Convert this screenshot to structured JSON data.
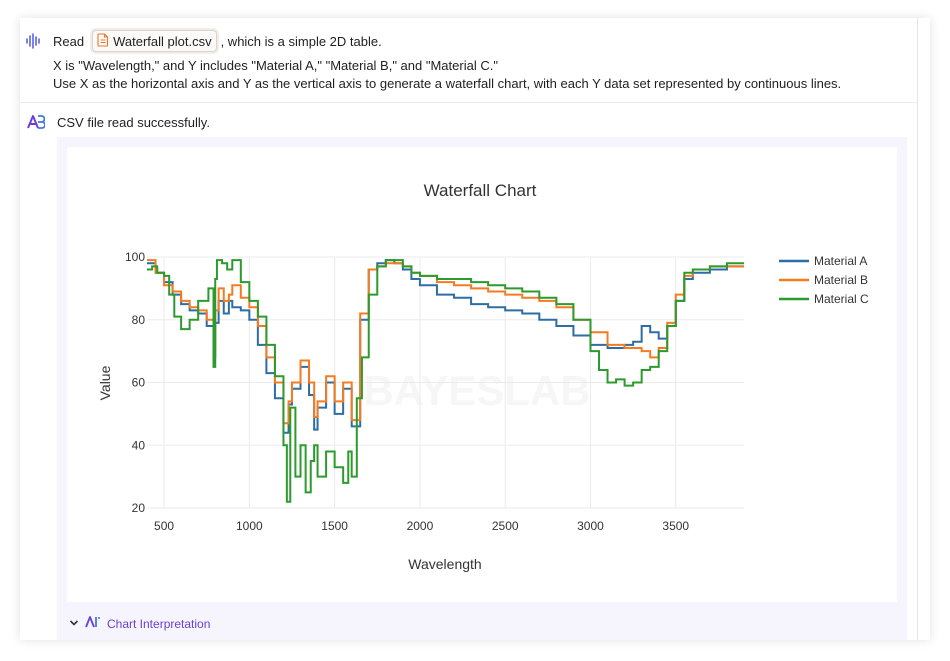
{
  "user_message": {
    "read_prefix": "Read",
    "file_name": "Waterfall plot.csv",
    "read_suffix": ", which is a simple 2D table.",
    "line2": "X is \"Wavelength,\" and Y includes \"Material A,\" \"Material B,\" and \"Material C.\"",
    "line3": "Use X as the horizontal axis and Y as the vertical axis to generate a waterfall chart, with each Y data set represented by continuous lines."
  },
  "assistant": {
    "status": "CSV file read successfully.",
    "interpretation_label": "Chart Interpretation"
  },
  "colors": {
    "material_a": "#2e6da4",
    "material_b": "#f47b20",
    "material_c": "#2c9a2c",
    "accent": "#6b3fd6"
  },
  "chart_data": {
    "type": "line",
    "title": "Waterfall Chart",
    "xlabel": "Wavelength",
    "ylabel": "Value",
    "xlim": [
      400,
      3900
    ],
    "ylim": [
      20,
      100
    ],
    "xticks": [
      500,
      1000,
      1500,
      2000,
      2500,
      3000,
      3500
    ],
    "yticks": [
      20,
      40,
      60,
      80,
      100
    ],
    "grid": true,
    "legend_position": "top-right",
    "watermark": "BAYESLAB",
    "series": [
      {
        "name": "Material A",
        "color_key": "material_a",
        "x": [
          400,
          450,
          500,
          550,
          600,
          650,
          700,
          750,
          790,
          800,
          820,
          850,
          880,
          900,
          950,
          1000,
          1050,
          1100,
          1150,
          1200,
          1230,
          1250,
          1300,
          1350,
          1380,
          1400,
          1450,
          1500,
          1550,
          1600,
          1650,
          1700,
          1750,
          1800,
          1850,
          1900,
          1950,
          2000,
          2100,
          2200,
          2300,
          2400,
          2500,
          2600,
          2700,
          2800,
          2900,
          3000,
          3100,
          3200,
          3250,
          3300,
          3350,
          3400,
          3450,
          3500,
          3550,
          3600,
          3700,
          3800,
          3900
        ],
        "y": [
          98,
          95,
          92,
          88,
          85,
          83,
          82,
          78,
          68,
          79,
          86,
          82,
          86,
          84,
          83,
          80,
          72,
          63,
          55,
          44,
          53,
          58,
          65,
          56,
          45,
          52,
          60,
          50,
          58,
          46,
          80,
          96,
          98,
          99,
          98,
          96,
          93,
          91,
          88,
          87,
          85,
          84,
          83,
          82,
          80,
          78,
          75,
          72,
          71,
          72,
          73,
          78,
          76,
          74,
          78,
          86,
          93,
          95,
          96,
          97,
          97
        ]
      },
      {
        "name": "Material B",
        "color_key": "material_b",
        "x": [
          400,
          450,
          500,
          550,
          600,
          650,
          700,
          750,
          790,
          800,
          820,
          850,
          880,
          900,
          950,
          1000,
          1050,
          1100,
          1150,
          1200,
          1230,
          1250,
          1300,
          1350,
          1380,
          1400,
          1450,
          1500,
          1550,
          1600,
          1650,
          1700,
          1750,
          1800,
          1850,
          1900,
          1950,
          2000,
          2100,
          2200,
          2300,
          2400,
          2500,
          2600,
          2700,
          2800,
          2900,
          3000,
          3100,
          3200,
          3250,
          3300,
          3350,
          3400,
          3450,
          3500,
          3550,
          3600,
          3700,
          3800,
          3900
        ],
        "y": [
          99,
          95,
          91,
          89,
          86,
          84,
          83,
          80,
          72,
          83,
          90,
          86,
          88,
          91,
          87,
          84,
          78,
          68,
          60,
          47,
          54,
          60,
          67,
          60,
          49,
          54,
          62,
          54,
          60,
          48,
          82,
          96,
          97,
          98,
          98,
          97,
          95,
          94,
          92,
          91,
          90,
          89,
          88,
          87,
          86,
          84,
          80,
          76,
          72,
          71,
          71,
          70,
          68,
          71,
          79,
          88,
          94,
          96,
          97,
          97,
          97
        ]
      },
      {
        "name": "Material C",
        "color_key": "material_c",
        "x": [
          400,
          430,
          460,
          500,
          530,
          560,
          600,
          650,
          700,
          760,
          790,
          800,
          810,
          840,
          870,
          900,
          950,
          1000,
          1050,
          1100,
          1150,
          1200,
          1220,
          1240,
          1270,
          1300,
          1330,
          1360,
          1380,
          1400,
          1450,
          1500,
          1550,
          1580,
          1600,
          1630,
          1660,
          1700,
          1750,
          1800,
          1850,
          1900,
          1950,
          2000,
          2100,
          2200,
          2300,
          2400,
          2500,
          2600,
          2700,
          2800,
          2900,
          3000,
          3050,
          3100,
          3150,
          3200,
          3250,
          3300,
          3350,
          3400,
          3450,
          3500,
          3550,
          3600,
          3700,
          3800,
          3900
        ],
        "y": [
          96,
          97,
          95,
          94,
          88,
          81,
          77,
          80,
          86,
          90,
          65,
          93,
          99,
          98,
          96,
          99,
          92,
          86,
          81,
          72,
          62,
          40,
          22,
          52,
          30,
          40,
          25,
          35,
          40,
          30,
          38,
          33,
          28,
          38,
          30,
          55,
          68,
          88,
          97,
          99,
          99,
          97,
          95,
          94,
          93,
          93,
          92,
          91,
          90,
          89,
          87,
          85,
          80,
          70,
          64,
          60,
          61,
          59,
          60,
          64,
          65,
          70,
          78,
          86,
          95,
          96,
          97,
          98,
          98
        ]
      }
    ]
  }
}
